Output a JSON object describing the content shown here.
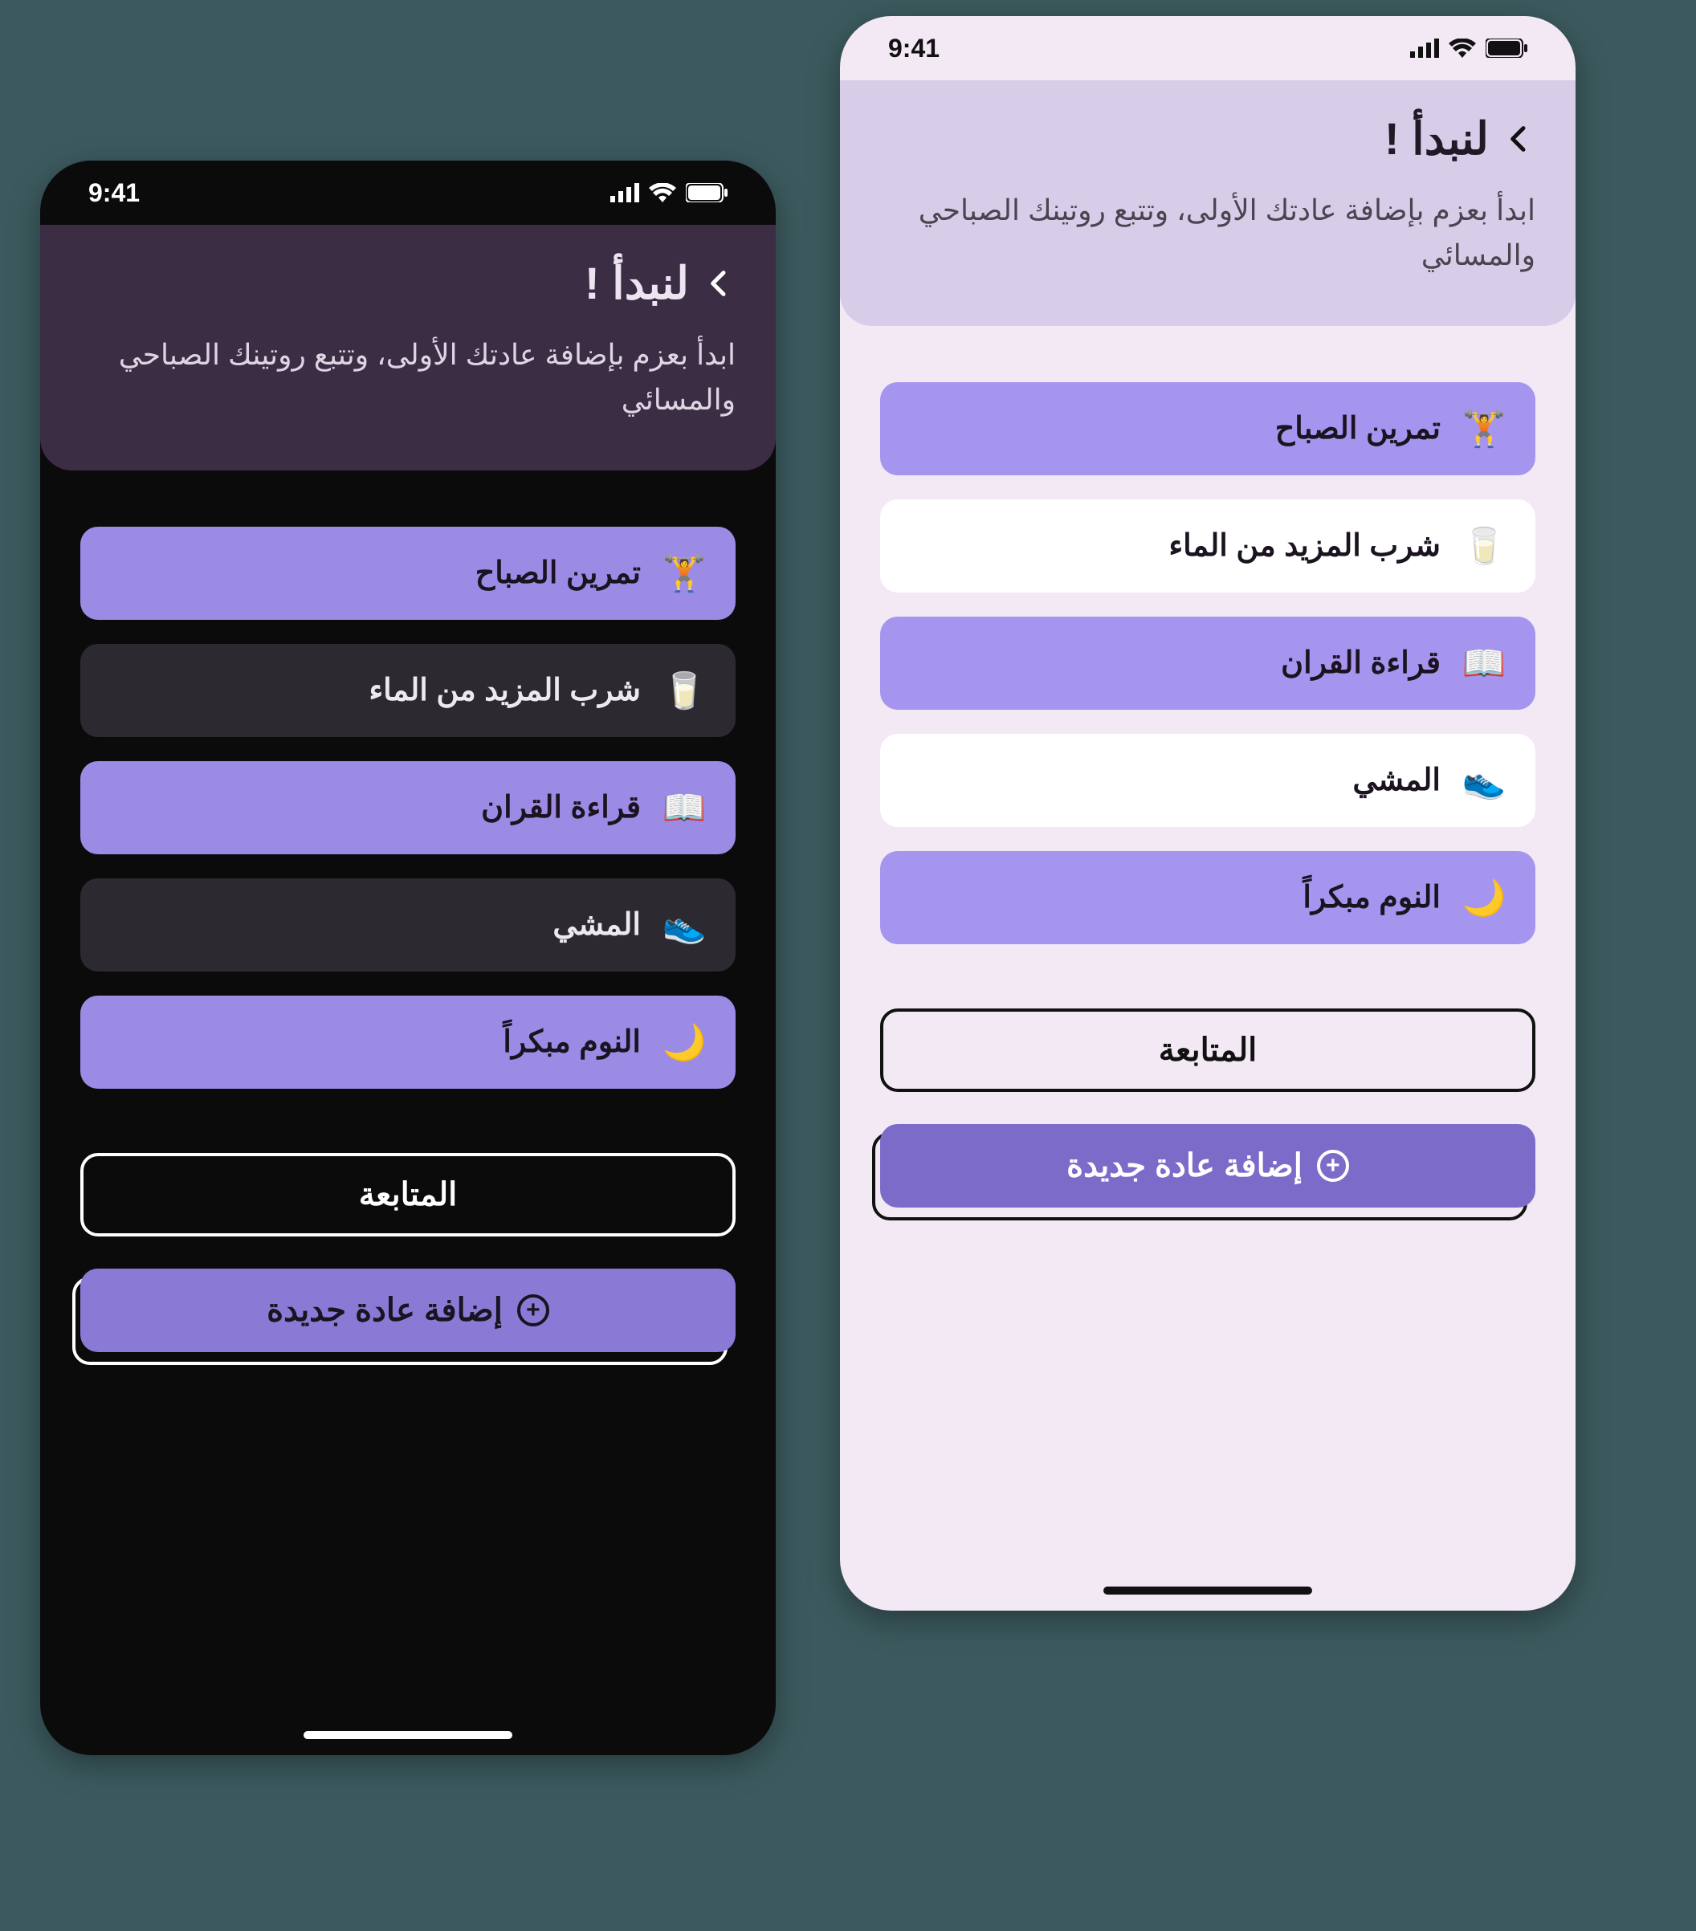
{
  "status": {
    "time": "9:41"
  },
  "colors": {
    "accent_dark": "#8a7ad6",
    "accent_light": "#7d6bc9",
    "selected_dark": "#9b8be5",
    "selected_light": "#a695ef",
    "header_dark": "#3a2d44",
    "header_light": "#d8cde8"
  },
  "header": {
    "title": "لنبدأ !",
    "subtitle": "ابدأ بعزم بإضافة عادتك الأولى، وتتبع روتينك الصباحي والمسائي"
  },
  "habits": [
    {
      "id": "morning-workout",
      "icon": "dumbbell-icon",
      "emoji": "🏋️",
      "label": "تمرين الصباح",
      "selected": true
    },
    {
      "id": "drink-water",
      "icon": "glass-icon",
      "emoji": "🥛",
      "label": "شرب المزيد من الماء",
      "selected": false
    },
    {
      "id": "read-quran",
      "icon": "book-icon",
      "emoji": "📖",
      "label": "قراءة القران",
      "selected": true
    },
    {
      "id": "walking",
      "icon": "shoe-icon",
      "emoji": "👟",
      "label": "المشي",
      "selected": false
    },
    {
      "id": "sleep-early",
      "icon": "moon-icon",
      "emoji": "🌙",
      "label": "النوم مبكراً",
      "selected": true
    }
  ],
  "buttons": {
    "continue": "المتابعة",
    "add_new": "إضافة عادة جديدة"
  }
}
